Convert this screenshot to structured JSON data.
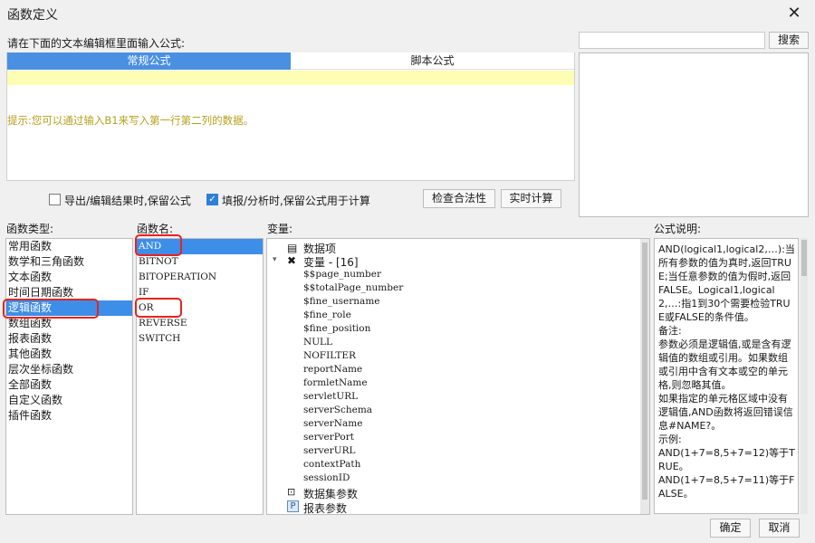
{
  "window": {
    "title": "函数定义"
  },
  "prompt": "请在下面的文本编辑框里面输入公式:",
  "search": {
    "button": "搜索"
  },
  "editor": {
    "tabs": [
      "常规公式",
      "脚本公式"
    ],
    "hint": "提示:您可以通过输入B1来写入第一行第二列的数据。"
  },
  "options": {
    "export_keep": "导出/编辑结果时,保留公式",
    "fill_keep": "填报/分析时,保留公式用于计算",
    "check_button": "检查合法性",
    "realtime_button": "实时计算"
  },
  "labels": {
    "types": "函数类型:",
    "names": "函数名:",
    "vars": "变量:",
    "desc": "公式说明:"
  },
  "function_types": [
    "常用函数",
    "数学和三角函数",
    "文本函数",
    "时间日期函数",
    "逻辑函数",
    "数组函数",
    "报表函数",
    "其他函数",
    "层次坐标函数",
    "全部函数",
    "自定义函数",
    "插件函数"
  ],
  "function_names": [
    "AND",
    "BITNOT",
    "BITOPERATION",
    "IF",
    "OR",
    "REVERSE",
    "SWITCH"
  ],
  "variables": {
    "data_item": "数据项",
    "group": "变量 - [16]",
    "items": [
      "$$page_number",
      "$$totalPage_number",
      "$fine_username",
      "$fine_role",
      "$fine_position",
      "NULL",
      "NOFILTER",
      "reportName",
      "formletName",
      "servletURL",
      "serverSchema",
      "serverName",
      "serverPort",
      "serverURL",
      "contextPath",
      "sessionID"
    ],
    "dataset_params": "数据集参数",
    "report_params": "报表参数"
  },
  "description": "AND(logical1,logical2,…):当所有参数的值为真时,返回TRUE;当任意参数的值为假时,返回FALSE。Logical1,logical2,…:指1到30个需要检验TRUE或FALSE的条件值。\n备注:\n参数必须是逻辑值,或是含有逻辑值的数组或引用。如果数组或引用中含有文本或空的单元格,则忽略其值。\n如果指定的单元格区域中没有逻辑值,AND函数将返回错误信息#NAME?。\n示例:\nAND(1+7=8,5+7=12)等于TRUE。\nAND(1+7=8,5+7=11)等于FALSE。",
  "footer": {
    "ok": "确定",
    "cancel": "取消"
  },
  "colors": {
    "accent": "#3d8ee8",
    "highlight_box": "#e8231c",
    "hint_text": "#b5a01e"
  }
}
